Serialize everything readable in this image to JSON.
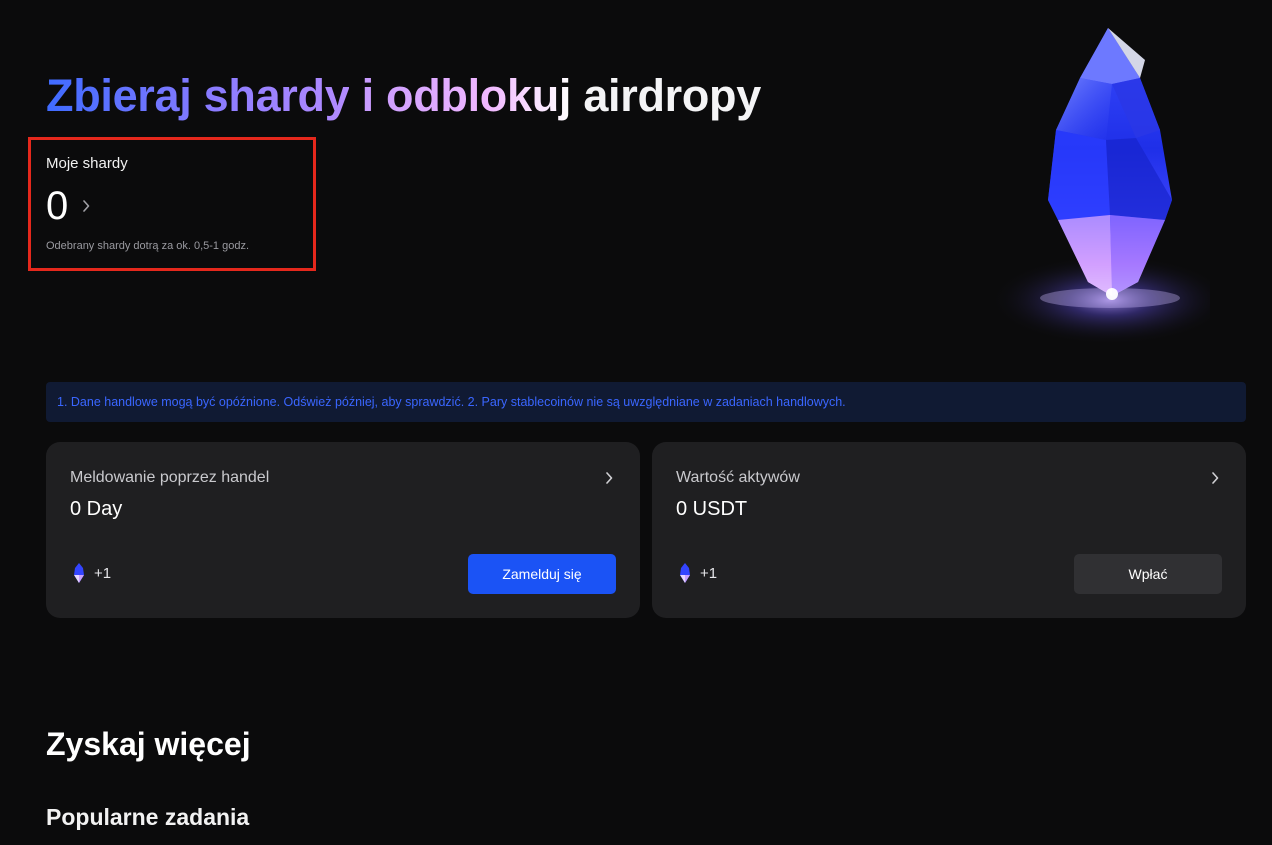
{
  "hero": {
    "title_part1": "Zbieraj shardy",
    "title_part2": "i odblokuj",
    "title_part3": "airdropy"
  },
  "shards": {
    "label": "Moje shardy",
    "value": "0",
    "note": "Odebrany shardy dotrą za ok. 0,5-1 godz."
  },
  "notice": {
    "text": "1. Dane handlowe mogą być opóźnione. Odśwież później, aby sprawdzić. 2. Pary stablecoinów nie są uwzględniane w zadaniach handlowych."
  },
  "cards": [
    {
      "title": "Meldowanie poprzez handel",
      "value": "0 Day",
      "reward": "+1",
      "button_label": "Zamelduj się"
    },
    {
      "title": "Wartość aktywów",
      "value": "0 USDT",
      "reward": "+1",
      "button_label": "Wpłać"
    }
  ],
  "more": {
    "title": "Zyskaj więcej",
    "subtitle": "Popularne zadania"
  },
  "colors": {
    "accent": "#1b53f5",
    "notice_text": "#3a66ff",
    "highlight_border": "#e5281c"
  }
}
